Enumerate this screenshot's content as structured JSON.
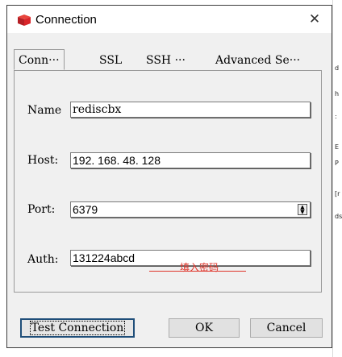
{
  "window": {
    "title": "Connection"
  },
  "tabs": [
    "Conn···",
    "SSL",
    "SSH ···",
    "Advanced Se···"
  ],
  "form": {
    "name_label": "Name",
    "name_value": "rediscbx",
    "host_label": "Host:",
    "host_value": "192. 168. 48. 128",
    "port_label": "Port:",
    "port_value": "6379",
    "auth_label": "Auth:",
    "auth_value": "131224abcd"
  },
  "annotation": "填入密码",
  "buttons": {
    "test": "Test Connection",
    "ok": "OK",
    "cancel": "Cancel"
  },
  "background_fragments": [
    "d",
    "h",
    ":",
    "E",
    "P",
    "[r",
    "ds"
  ],
  "colors": {
    "annotation": "#e0352b",
    "app_icon": "#d9252a"
  }
}
